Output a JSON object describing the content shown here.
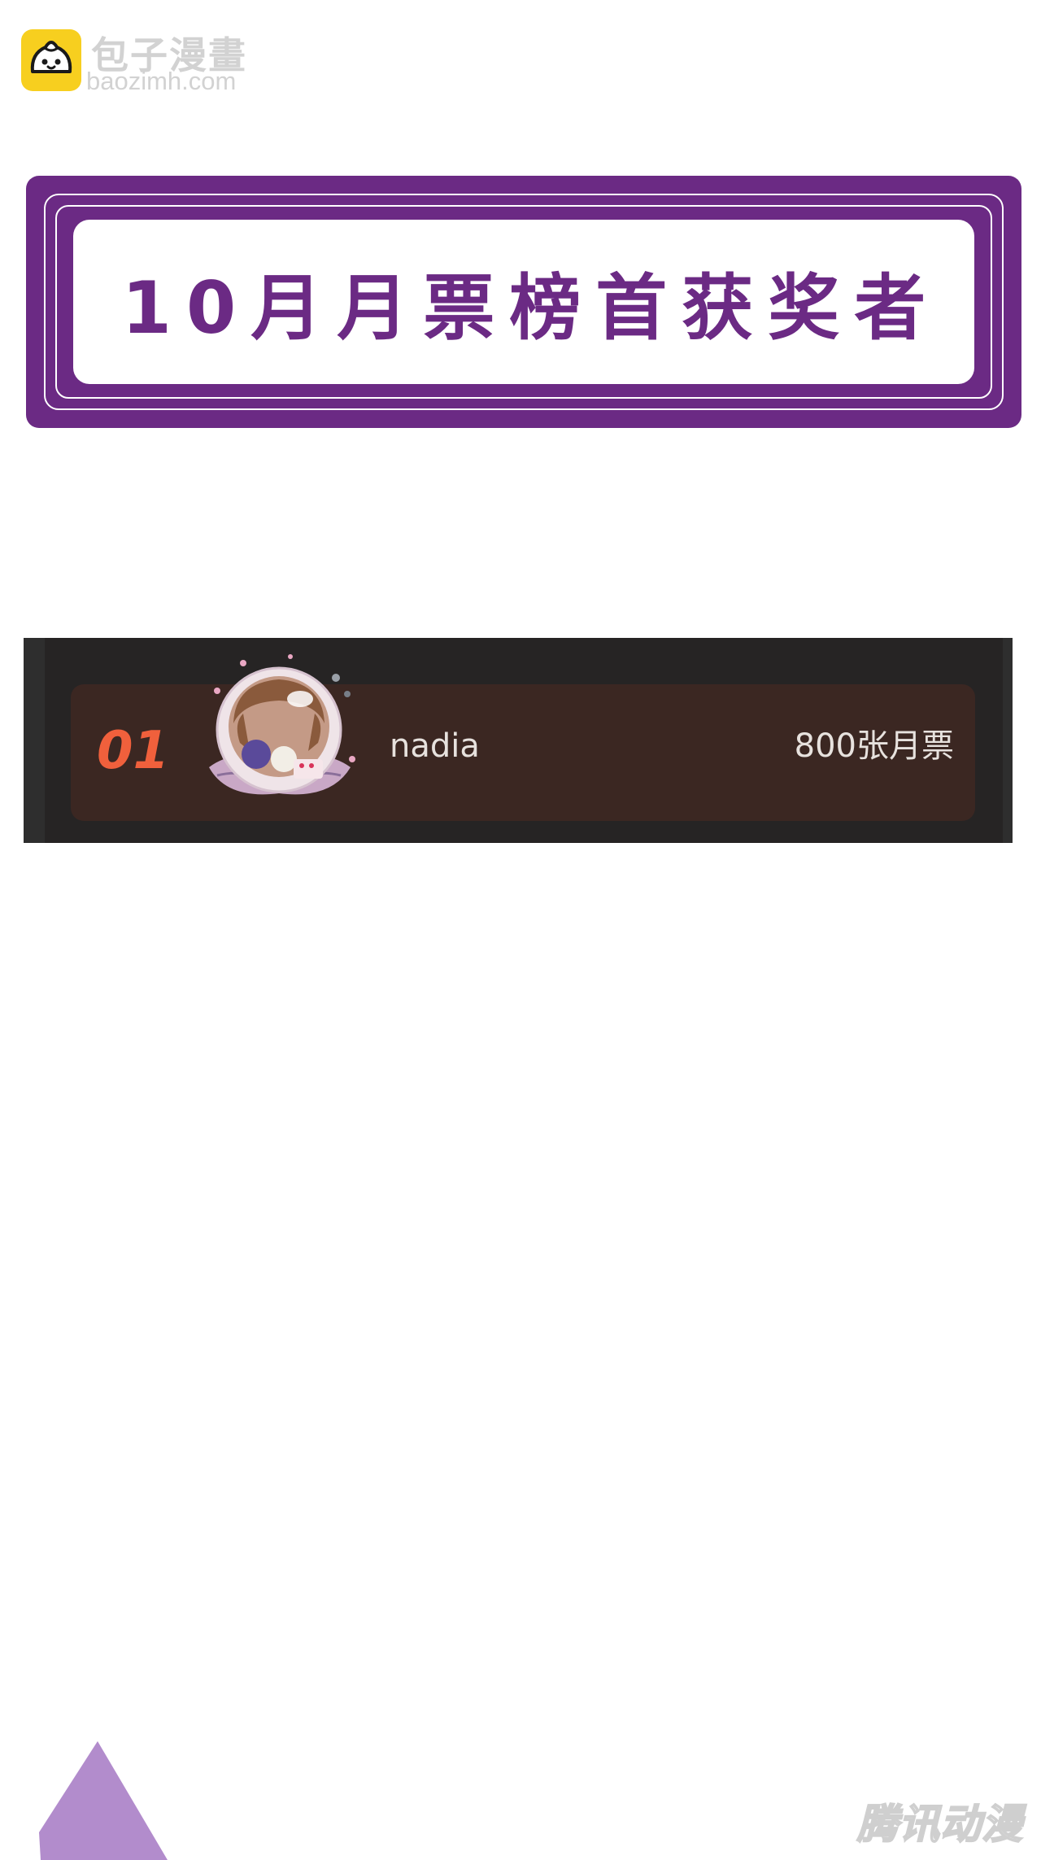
{
  "watermark": {
    "site_name_cn": "包子漫畫",
    "site_domain": "baozimh.com",
    "logo_icon": "bun-face-icon"
  },
  "banner": {
    "title": "10月月票榜首获奖者"
  },
  "ranking": [
    {
      "rank": "01",
      "username": "nadia",
      "votes": "800张月票",
      "avatar_icon": "user-avatar"
    }
  ],
  "brand_watermark": "腾讯动漫",
  "colors": {
    "banner_purple": "#6b2a84",
    "panel_bg": "#262424",
    "row_bg": "#3b2722",
    "rank_orange": "#f0603c",
    "triangle_lilac": "#b28ccc",
    "logo_yellow": "#f7cf1f"
  }
}
